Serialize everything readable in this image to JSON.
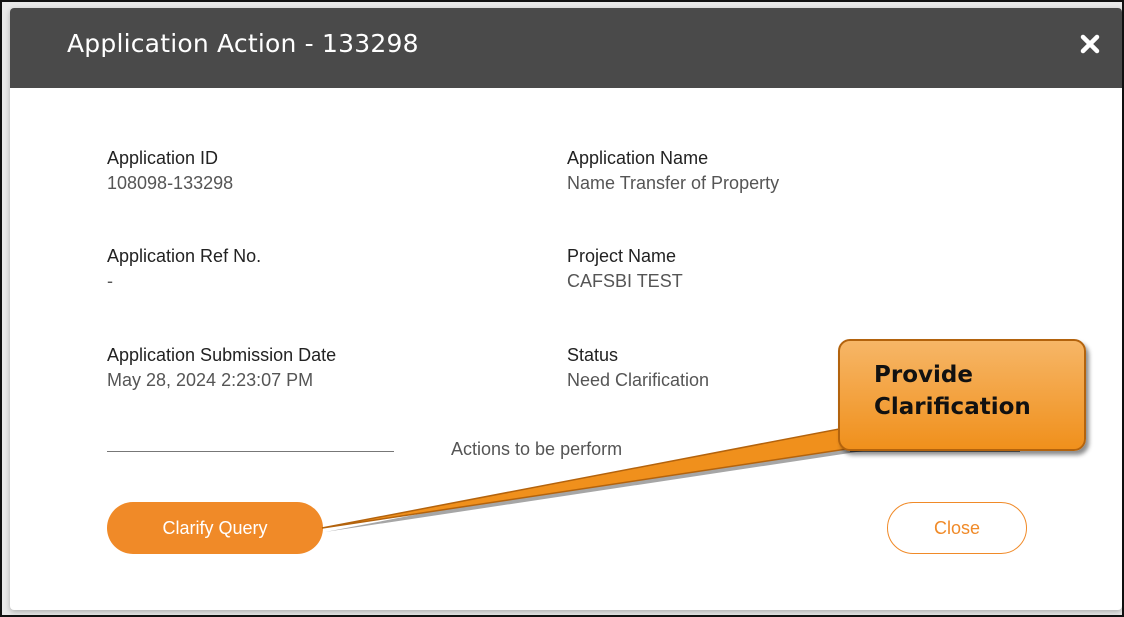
{
  "dialog": {
    "title": "Application Action - 133298",
    "close_icon": "close-icon"
  },
  "fields": {
    "application_id": {
      "label": "Application ID",
      "value": "108098-133298"
    },
    "application_name": {
      "label": "Application Name",
      "value": "Name Transfer of Property"
    },
    "application_ref_no": {
      "label": "Application Ref No.",
      "value": "-"
    },
    "project_name": {
      "label": "Project Name",
      "value": "CAFSBI TEST"
    },
    "submission_date": {
      "label": "Application Submission Date",
      "value": "May 28, 2024 2:23:07 PM"
    },
    "status": {
      "label": "Status",
      "value": "Need Clarification"
    }
  },
  "actions_section": {
    "text": "Actions to be perform"
  },
  "buttons": {
    "clarify_query": "Clarify Query",
    "close": "Close"
  },
  "callout": {
    "line1": "Provide",
    "line2": "Clarification"
  },
  "colors": {
    "header_bg": "#4a4a4a",
    "accent": "#f08a28",
    "callout_fill": "#f0901c"
  }
}
